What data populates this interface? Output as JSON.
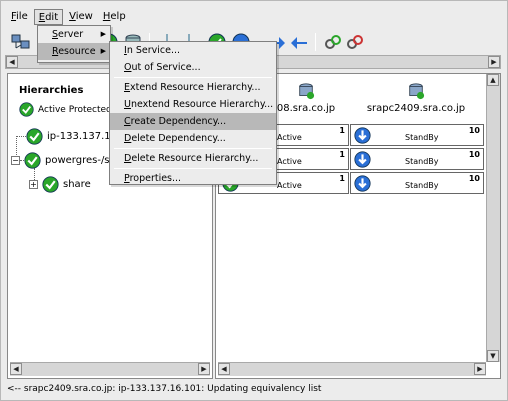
{
  "menubar": {
    "items": [
      {
        "label": "File",
        "mnemonic": "F",
        "rest": "ile"
      },
      {
        "label": "Edit",
        "mnemonic": "E",
        "rest": "dit"
      },
      {
        "label": "View",
        "mnemonic": "V",
        "rest": "iew"
      },
      {
        "label": "Help",
        "mnemonic": "H",
        "rest": "elp"
      }
    ]
  },
  "edit_menu": {
    "items": [
      {
        "label": "Server",
        "mnemonic": "S",
        "rest": "erver"
      },
      {
        "label": "Resource",
        "mnemonic": "R",
        "rest": "esource"
      }
    ]
  },
  "resource_menu": {
    "items": [
      {
        "label": "In Service...",
        "mnemonic": "I",
        "rest": "n Service..."
      },
      {
        "label": "Out of Service...",
        "mnemonic": "O",
        "rest": "ut of Service..."
      },
      {
        "label": "Extend Resource Hierarchy...",
        "mnemonic": "E",
        "rest": "xtend Resource Hierarchy..."
      },
      {
        "label": "Unextend Resource Hierarchy...",
        "mnemonic": "U",
        "rest": "nextend Resource Hierarchy..."
      },
      {
        "label": "Create Dependency...",
        "mnemonic": "C",
        "rest": "reate Dependency..."
      },
      {
        "label": "Delete Dependency...",
        "mnemonic": "D",
        "rest": "elete Dependency..."
      },
      {
        "label": "Delete Resource Hierarchy...",
        "mnemonic": "D",
        "rest": "elete Resource Hierarchy..."
      },
      {
        "label": "Properties...",
        "mnemonic": "P",
        "rest": "roperties..."
      }
    ],
    "highlighted_index": 4
  },
  "left_panel": {
    "title": "Hierarchies",
    "status_label": "Active Protected",
    "tree": [
      {
        "label": "ip-133.137.16"
      },
      {
        "label": "powergres-/s"
      },
      {
        "label": "share"
      }
    ]
  },
  "right_panel": {
    "servers": [
      {
        "name": "srapc2408.sra.co.jp",
        "visible": "08.sra.co.jp"
      },
      {
        "name": "srapc2409.sra.co.jp",
        "visible": "srapc2409.sra.co.jp"
      }
    ],
    "rows": [
      {
        "left_state": "Active",
        "left_priority": "1",
        "right_state": "StandBy",
        "right_priority": "10"
      },
      {
        "left_state": "Active",
        "left_priority": "1",
        "right_state": "StandBy",
        "right_priority": "10"
      },
      {
        "left_state": "Active",
        "left_priority": "1",
        "right_state": "StandBy",
        "right_priority": "10"
      }
    ]
  },
  "status_bar": {
    "text": "<-- srapc2409.sra.co.jp: ip-133.137.16.101: Updating equivalency list"
  },
  "colors": {
    "active_green": "#2aa62a",
    "standby_blue": "#2a6fd6",
    "menu_highlight": "#b8b8b8"
  }
}
